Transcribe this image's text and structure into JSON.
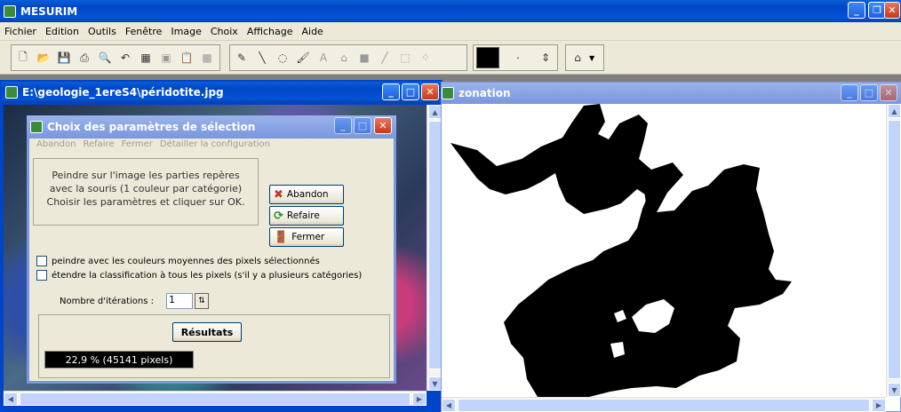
{
  "app": {
    "title": "MESURIM"
  },
  "menu": [
    "Fichier",
    "Edition",
    "Outils",
    "Fenêtre",
    "Image",
    "Choix",
    "Affichage",
    "Aide"
  ],
  "toolbar": {
    "color_swatch": "#000000",
    "dot": "·"
  },
  "left_window": {
    "title": "E:\\geologie_1ereS4\\péridotite.jpg"
  },
  "dialog": {
    "title": "Choix des paramètres de sélection",
    "menu": [
      "Abandon",
      "Refaire",
      "Fermer",
      "Détailler la configuration"
    ],
    "instructions": [
      "Peindre sur l'image les parties repères",
      "avec la souris (1 couleur par catégorie)",
      "Choisir les paramètres et cliquer sur OK."
    ],
    "buttons": {
      "abandon": "Abandon",
      "refaire": "Refaire",
      "fermer": "Fermer"
    },
    "checkbox1": "peindre avec les couleurs moyennes des pixels sélectionnés",
    "checkbox2": "étendre la classification à tous les pixels (s'il y a plusieurs catégories)",
    "iterations_label": "Nombre d'itérations :",
    "iterations_value": "1",
    "results_button": "Résultats",
    "result_text": "22,9 % (45141 pixels)"
  },
  "right_window": {
    "title": "zonation"
  }
}
